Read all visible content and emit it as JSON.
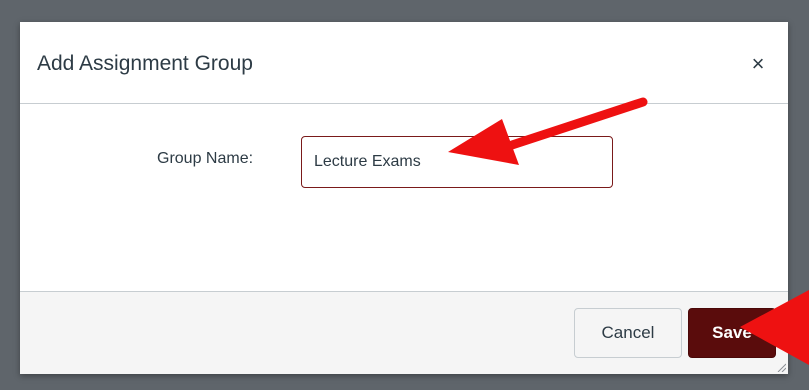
{
  "dialog": {
    "title": "Add Assignment Group",
    "close_glyph": "×",
    "field_label": "Group Name:",
    "group_name_value": "Lecture Exams",
    "cancel_label": "Cancel",
    "save_label": "Save"
  },
  "colors": {
    "overlay": "#5f656b",
    "save_button": "#5a0c0c",
    "input_border": "#7a1a1a",
    "annotation_arrow": "#ee1111"
  },
  "icons": {
    "close": "close-icon",
    "resize": "resize-handle-icon",
    "arrow": "red-arrow-annotation"
  }
}
